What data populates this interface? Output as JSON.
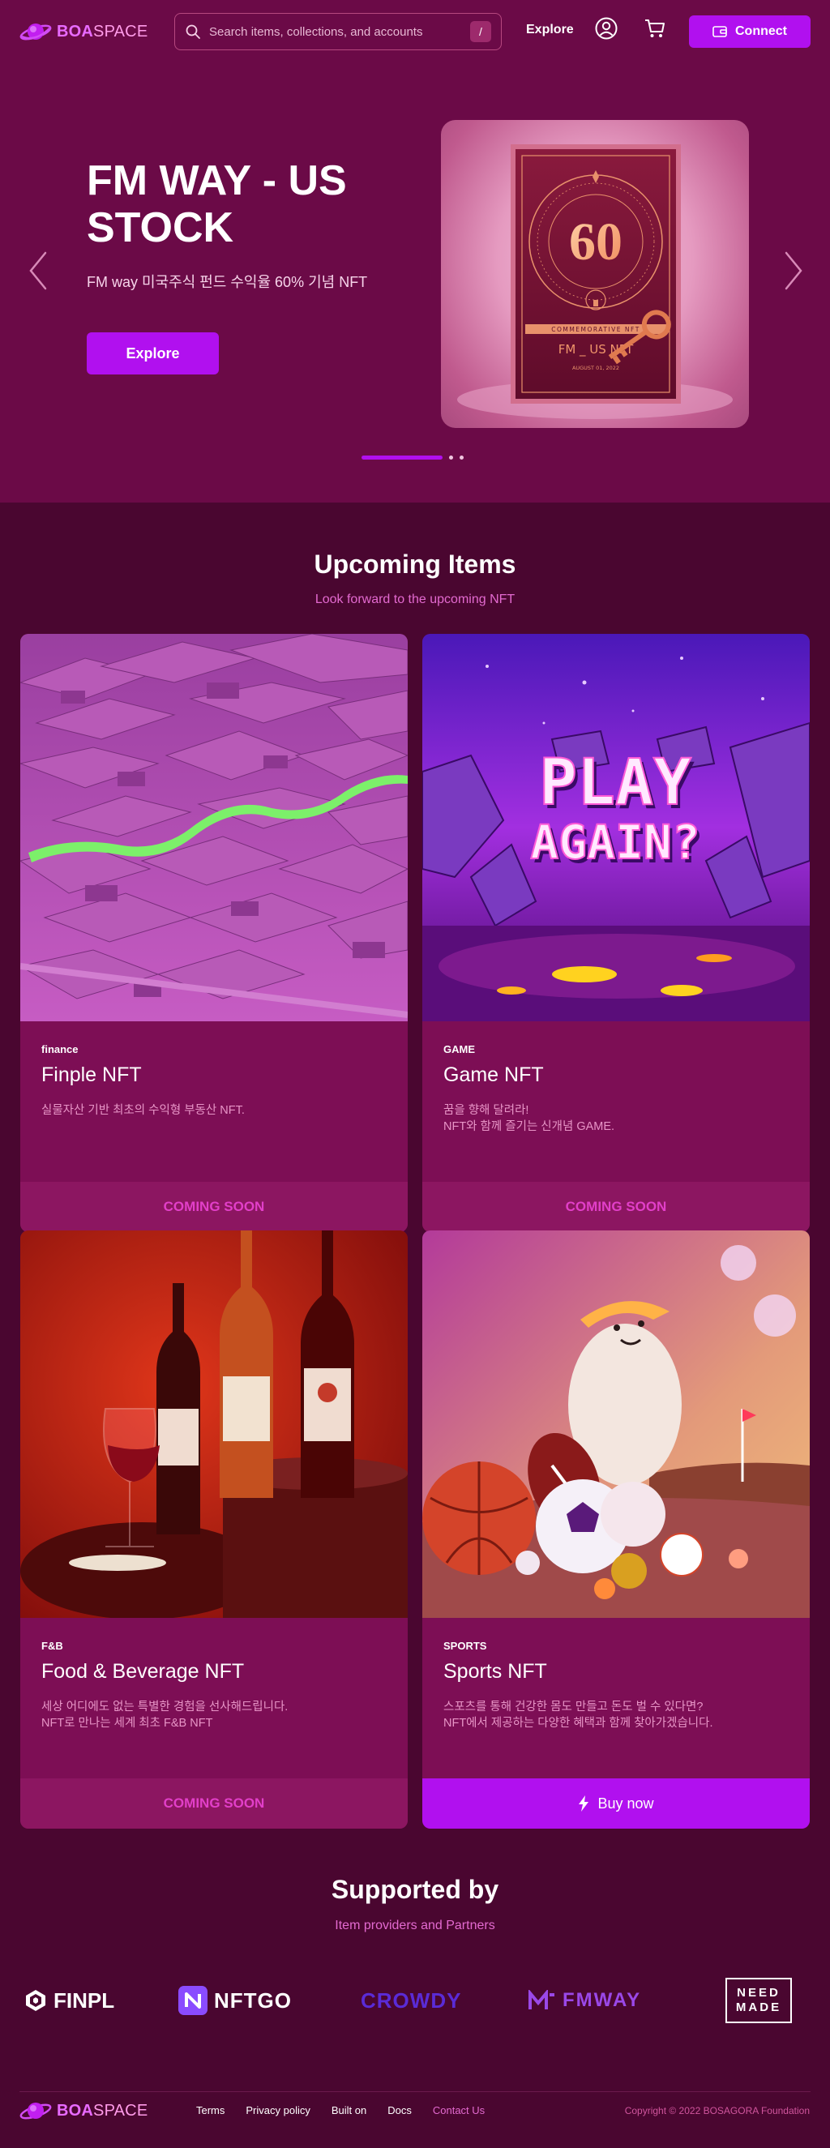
{
  "header": {
    "logo_boa": "BOA",
    "logo_space": "SPACE",
    "search_placeholder": "Search items, collections, and accounts",
    "search_shortcut": "/",
    "nav_explore": "Explore",
    "connect_label": "Connect",
    "icons": [
      "search-icon",
      "account-icon",
      "cart-icon",
      "wallet-icon"
    ]
  },
  "hero": {
    "title": "FM WAY - US STOCK",
    "subtitle": "FM way 미국주식 펀드 수익율 60% 기념 NFT",
    "button_label": "Explore",
    "card_number": "60",
    "card_commemorative": "COMMEMORATIVE NFT",
    "card_name": "FM _ US NFT",
    "card_date": "AUGUST 01, 2022",
    "slides_total": 3,
    "slide_active": 1
  },
  "upcoming": {
    "title": "Upcoming Items",
    "subtitle": "Look forward to the upcoming NFT",
    "cards": [
      {
        "category": "finance",
        "title": "Finple NFT",
        "desc": [
          "실물자산 기반 최초의 수익형 부동산 NFT."
        ],
        "cta": "COMING SOON"
      },
      {
        "category": "GAME",
        "title": "Game NFT",
        "desc": [
          "꿈을 향해 달려라!",
          "NFT와 함께 즐기는 신개념 GAME."
        ],
        "cta": "COMING SOON",
        "image_text_1": "PLAY",
        "image_text_2": "AGAIN?"
      },
      {
        "category": "F&B",
        "title": "Food & Beverage NFT",
        "desc": [
          "세상 어디에도 없는 특별한 경험을 선사해드립니다.",
          "NFT로 만나는 세계 최초 F&B NFT"
        ],
        "cta": "COMING SOON"
      },
      {
        "category": "SPORTS",
        "title": "Sports NFT",
        "desc": [
          "스포츠를 통해 건강한 몸도 만들고 돈도 벌 수 있다면?",
          "NFT에서 제공하는 다양한 혜택과 함께 찾아가겠습니다."
        ],
        "cta": "Buy now"
      }
    ]
  },
  "supported": {
    "title": "Supported by",
    "subtitle": "Item providers and Partners",
    "partners": [
      "FINPL",
      "NFTGO",
      "CROWDY",
      "FMWAY",
      "NEED MADE"
    ]
  },
  "footer": {
    "links": [
      "Terms",
      "Privacy policy",
      "Built on",
      "Docs",
      "Contact Us"
    ],
    "copyright": "Copyright © 2022 BOSAGORA Foundation"
  },
  "colors": {
    "accent": "#b110ef",
    "header_bg": "#6b0a47",
    "page_bg": "#4a0630",
    "card_bg": "#7d0e55",
    "coming_soon": "#e23fc9"
  }
}
